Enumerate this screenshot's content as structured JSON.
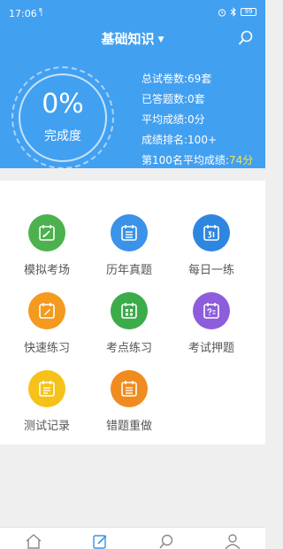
{
  "status_bar": {
    "time": "17:06",
    "signal": "ᴵᴵ|",
    "right_icons": [
      "alarm-icon",
      "bluetooth-icon",
      "battery-icon"
    ],
    "battery": "99"
  },
  "header": {
    "title": "基础知识",
    "caret": "▼",
    "search_icon": "search-icon"
  },
  "progress": {
    "percent_text": "0%",
    "label": "完成度"
  },
  "stats": [
    {
      "label": "总试卷数:",
      "value": "69套"
    },
    {
      "label": "已答题数:",
      "value": "0套"
    },
    {
      "label": "平均成绩:",
      "value": "0分"
    },
    {
      "label": "成绩排名:",
      "value": "100+"
    },
    {
      "label": "第100名平均成绩:",
      "value": "74分"
    }
  ],
  "grid": [
    {
      "label": "模拟考场",
      "color": "#4cb24e",
      "icon": "edit-calendar-icon"
    },
    {
      "label": "历年真题",
      "color": "#3a93e8",
      "icon": "list-calendar-icon"
    },
    {
      "label": "每日一练",
      "color": "#2f86df",
      "icon": "day-calendar-icon"
    },
    {
      "label": "快速练习",
      "color": "#f39a1f",
      "icon": "pen-calendar-icon"
    },
    {
      "label": "考点练习",
      "color": "#3cab4a",
      "icon": "grid-calendar-icon"
    },
    {
      "label": "考试押题",
      "color": "#8e5ddb",
      "icon": "question-calendar-icon"
    },
    {
      "label": "测试记录",
      "color": "#f6c219",
      "icon": "record-calendar-icon"
    },
    {
      "label": "错题重做",
      "color": "#f08b1f",
      "icon": "redo-calendar-icon"
    }
  ],
  "colors": {
    "brand": "#42a0f0",
    "highlight": "#f7e44a",
    "active_nav": "#3a93e8"
  },
  "bottom_nav": [
    "home-icon",
    "practice-icon",
    "discover-icon",
    "profile-icon"
  ]
}
